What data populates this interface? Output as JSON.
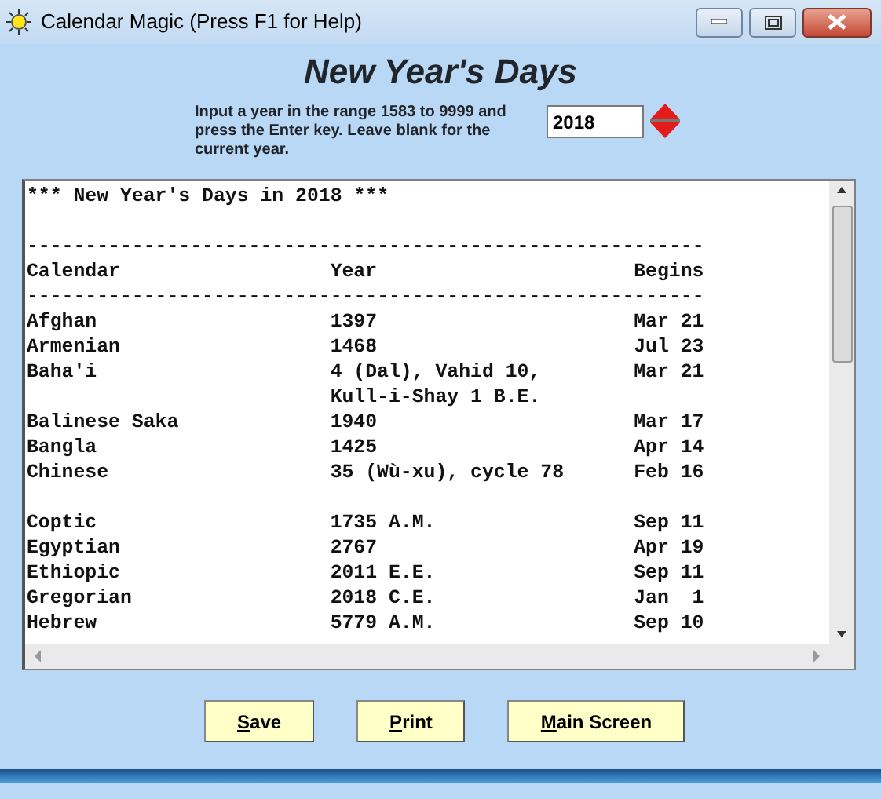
{
  "window": {
    "title": "Calendar Magic (Press F1 for Help)"
  },
  "heading": "New Year's Days",
  "instructions": "Input a year in the range 1583 to 9999 and press the Enter key. Leave blank for the current year.",
  "year_input": {
    "value": "2018"
  },
  "report": [
    {
      "kind": "title",
      "text": "*** New Year's Days in 2018 ***"
    },
    {
      "kind": "blank"
    },
    {
      "kind": "rule",
      "text": "----------------------------------------------------------"
    },
    {
      "kind": "row",
      "calendar": "Calendar",
      "year": "Year",
      "begins": "Begins"
    },
    {
      "kind": "rule",
      "text": "----------------------------------------------------------"
    },
    {
      "kind": "row",
      "calendar": "Afghan",
      "year": "1397",
      "begins": "Mar 21"
    },
    {
      "kind": "row",
      "calendar": "Armenian",
      "year": "1468",
      "begins": "Jul 23"
    },
    {
      "kind": "row",
      "calendar": "Baha'i",
      "year": "4 (Dal), Vahid 10,",
      "begins": "Mar 21"
    },
    {
      "kind": "row",
      "year": "Kull-i-Shay 1 B.E."
    },
    {
      "kind": "row",
      "calendar": "Balinese Saka",
      "year": "1940",
      "begins": "Mar 17"
    },
    {
      "kind": "row",
      "calendar": "Bangla",
      "year": "1425",
      "begins": "Apr 14"
    },
    {
      "kind": "row",
      "calendar": "Chinese",
      "year": "35 (Wù-xu), cycle 78",
      "begins": "Feb 16"
    },
    {
      "kind": "blank"
    },
    {
      "kind": "row",
      "calendar": "Coptic",
      "year": "1735 A.M.",
      "begins": "Sep 11"
    },
    {
      "kind": "row",
      "calendar": "Egyptian",
      "year": "2767",
      "begins": "Apr 19"
    },
    {
      "kind": "row",
      "calendar": "Ethiopic",
      "year": "2011 E.E.",
      "begins": "Sep 11"
    },
    {
      "kind": "row",
      "calendar": "Gregorian",
      "year": "2018 C.E.",
      "begins": "Jan  1"
    },
    {
      "kind": "row",
      "calendar": "Hebrew",
      "year": "5779 A.M.",
      "begins": "Sep 10"
    }
  ],
  "buttons": [
    {
      "mnemonic": "S",
      "rest": "ave"
    },
    {
      "mnemonic": "P",
      "rest": "rint"
    },
    {
      "mnemonic": "M",
      "rest": "ain Screen"
    }
  ]
}
